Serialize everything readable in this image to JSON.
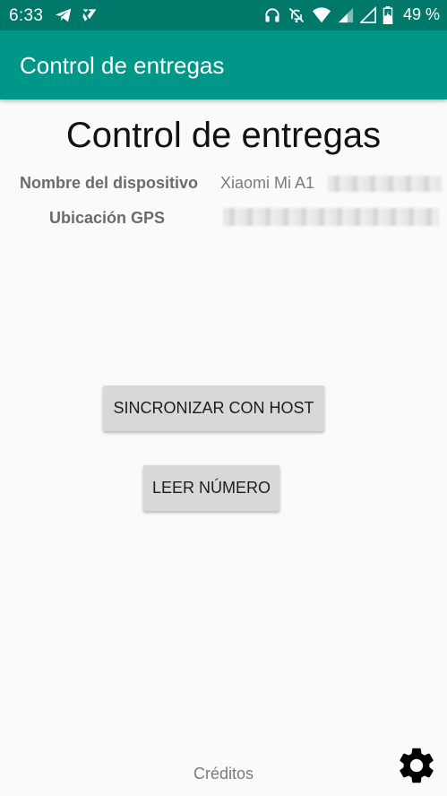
{
  "status_bar": {
    "time": "6:33",
    "battery_text": "49 %",
    "icons": [
      "telegram-icon",
      "feedly-icon",
      "headset-icon",
      "alarm-off-icon",
      "wifi-icon",
      "signal-icon",
      "signal-empty-icon",
      "battery-icon"
    ]
  },
  "app_bar": {
    "title": "Control de entregas",
    "color": "#009688",
    "status_color": "#00796b"
  },
  "main": {
    "title": "Control de entregas",
    "device_label": "Nombre del dispositivo",
    "device_value": "Xiaomi Mi A1",
    "gps_label": "Ubicación GPS",
    "sync_button": "SINCRONIZAR CON HOST",
    "read_button": "LEER NÚMERO",
    "credits": "Créditos",
    "settings_icon": "gear-icon"
  }
}
